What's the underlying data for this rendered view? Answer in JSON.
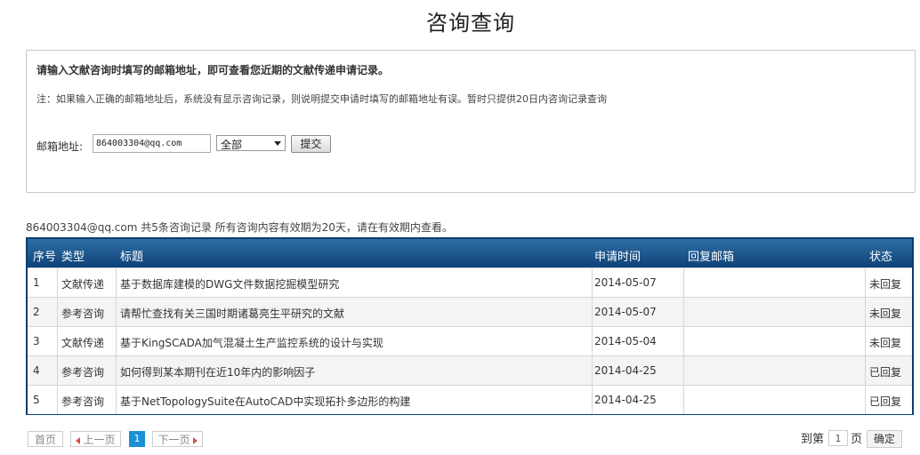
{
  "page": {
    "title": "咨询查询"
  },
  "query": {
    "heading": "请输入文献咨询时填写的邮箱地址，即可查看您近期的文献传递申请记录。",
    "note": "注：如果输入正确的邮箱地址后，系统没有显示咨询记录，则说明提交申请时填写的邮箱地址有误。暂时只提供20日内咨询记录查询",
    "email_label": "邮箱地址:",
    "email_value": "864003304@qq.com",
    "type_selected": "全部",
    "submit_label": "提交"
  },
  "summary": "864003304@qq.com 共5条咨询记录 所有咨询内容有效期为20天，请在有效期内查看。",
  "table": {
    "headers": {
      "no": "序号",
      "type": "类型",
      "title": "标题",
      "date": "申请时间",
      "reply": "回复邮箱",
      "status": "状态"
    },
    "rows": [
      {
        "no": "1",
        "type": "文献传递",
        "title": "基于数据库建模的DWG文件数据挖掘模型研究",
        "date": "2014-05-07",
        "reply": "",
        "status": "未回复"
      },
      {
        "no": "2",
        "type": "参考咨询",
        "title": "请帮忙查找有关三国时期诸葛亮生平研究的文献",
        "date": "2014-05-07",
        "reply": "",
        "status": "未回复"
      },
      {
        "no": "3",
        "type": "文献传递",
        "title": "基于KingSCADA加气混凝土生产监控系统的设计与实现",
        "date": "2014-05-04",
        "reply": "",
        "status": "未回复"
      },
      {
        "no": "4",
        "type": "参考咨询",
        "title": "如何得到某本期刊在近10年内的影响因子",
        "date": "2014-04-25",
        "reply": "",
        "status": "已回复"
      },
      {
        "no": "5",
        "type": "参考咨询",
        "title": "基于NetTopologySuite在AutoCAD中实现拓扑多边形的构建",
        "date": "2014-04-25",
        "reply": "",
        "status": "已回复"
      }
    ]
  },
  "pager": {
    "first": "首页",
    "prev": "上一页",
    "current": "1",
    "next": "下一页",
    "goto_prefix": "到第",
    "goto_value": "1",
    "goto_suffix": "页",
    "confirm": "确定"
  }
}
